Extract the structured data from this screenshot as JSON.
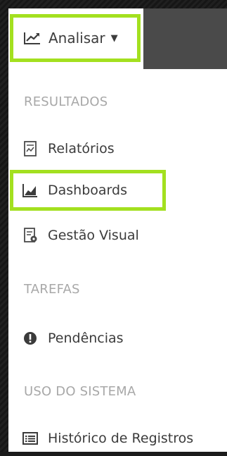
{
  "nav": {
    "analisar_label": "Analisar",
    "analisar_icon": "line-chart-icon",
    "caret_icon": "caret-down-icon"
  },
  "menu": {
    "sections": [
      {
        "title": "RESULTADOS",
        "items": [
          {
            "label": "Relatórios",
            "icon": "report-icon",
            "highlighted": false
          },
          {
            "label": "Dashboards",
            "icon": "area-chart-icon",
            "highlighted": true
          },
          {
            "label": "Gestão Visual",
            "icon": "visual-management-icon",
            "highlighted": false
          }
        ]
      },
      {
        "title": "TAREFAS",
        "items": [
          {
            "label": "Pendências",
            "icon": "exclamation-circle-icon",
            "highlighted": false
          }
        ]
      },
      {
        "title": "USO DO SISTEMA",
        "items": [
          {
            "label": "Histórico de Registros",
            "icon": "list-alt-icon",
            "highlighted": false
          }
        ]
      }
    ]
  },
  "colors": {
    "highlight": "#a3e01f",
    "section_text": "#a8a8a8",
    "item_text": "#3b3b3b",
    "topbar_dark": "#4a4a4a"
  }
}
